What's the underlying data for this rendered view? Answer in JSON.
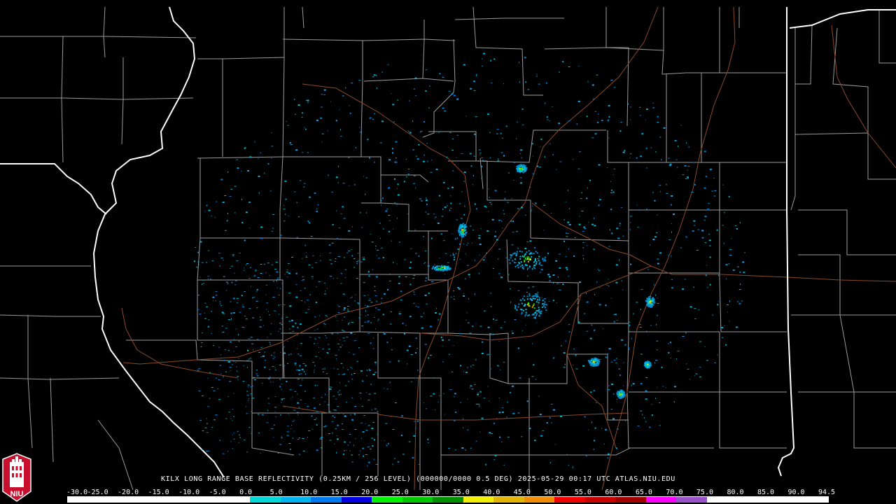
{
  "product": {
    "caption": "KILX LONG RANGE BASE REFLECTIVITY (0.25KM / 256 LEVEL) (000000/0000 0.5 DEG) 2025-05-29 00:17 UTC  ATLAS.NIU.EDU"
  },
  "logo": {
    "text": "NIU",
    "colors": {
      "primary": "#c8102e",
      "secondary": "#ffffff"
    }
  },
  "color_scale": {
    "labels": [
      "-30.0",
      "-25.0",
      "-20.0",
      "-15.0",
      "-10.0",
      "-5.0",
      "0.0",
      "5.0",
      "10.0",
      "15.0",
      "20.0",
      "25.0",
      "30.0",
      "35.0",
      "40.0",
      "45.0",
      "50.0",
      "55.0",
      "60.0",
      "65.0",
      "70.0",
      "75.0",
      "80.0",
      "85.0",
      "90.0",
      "94.5"
    ],
    "colors": [
      "#ffffff",
      "#ffffff",
      "#ffffff",
      "#ffffff",
      "#ffffff",
      "#ffffff",
      "#00d8d8",
      "#00b4f0",
      "#0078f0",
      "#0000e0",
      "#00f000",
      "#00c800",
      "#009000",
      "#f0f000",
      "#e0b400",
      "#f08c00",
      "#f00000",
      "#c80000",
      "#a00000",
      "#ff00ff",
      "#9a52c8",
      "#ffffff",
      "#ffffff",
      "#ffffff",
      "#ffffff"
    ]
  },
  "map": {
    "boundary_colors": {
      "state": "#ffffff",
      "county": "#9a9a9a",
      "highway": "#8a4a28"
    }
  }
}
